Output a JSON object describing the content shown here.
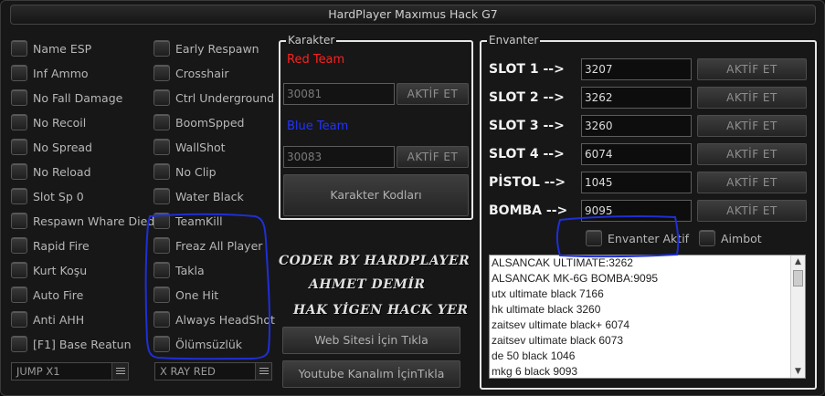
{
  "window": {
    "title": "HardPlayer Maxımus Hack G7"
  },
  "left_column": [
    "Name ESP",
    "Inf Ammo",
    "No Fall Damage",
    "No Recoil",
    "No Spread",
    "No Reload",
    "Slot Sp 0",
    "Respawn Whare Died",
    "Rapid Fire",
    "Kurt Koşu",
    "Auto Fire",
    "Anti AHH",
    "[F1] Base Reatun"
  ],
  "mid_column": [
    "Early Respawn",
    "Crosshair",
    "Ctrl Underground",
    "BoomSpped",
    "WallShot",
    "No Clip",
    "Water Black",
    "TeamKill",
    "Freaz All Player",
    "Takla",
    "One Hit",
    "Always HeadShot",
    "Ölümsüzlük"
  ],
  "combos": {
    "left_value": "JUMP X1",
    "mid_value": "X RAY RED"
  },
  "karakter": {
    "legend": "Karakter",
    "red_label": "Red Team",
    "red_value": "30081",
    "blue_label": "Blue Team",
    "blue_value": "30083",
    "activate_label": "AKTİF ET",
    "codes_button": "Karakter Kodları",
    "colors": {
      "red": "#ff2020",
      "blue": "#2233ff"
    }
  },
  "coder": {
    "line1": "CODER BY HARDPLAYER",
    "line2": "AHMET DEMİR",
    "line3": "HAK YİGEN HACK YER"
  },
  "links": {
    "website": "Web Sitesi İçin Tıkla",
    "youtube": "Youtube Kanalım İçinTıkla"
  },
  "envanter": {
    "legend": "Envanter",
    "activate_label": "AKTİF ET",
    "slots": [
      {
        "label": "SLOT 1 -->",
        "value": "3207"
      },
      {
        "label": "SLOT 2 -->",
        "value": "3262"
      },
      {
        "label": "SLOT 3 -->",
        "value": "3260"
      },
      {
        "label": "SLOT 4 -->",
        "value": "6074"
      },
      {
        "label": "PİSTOL -->",
        "value": "1045"
      },
      {
        "label": "BOMBA -->",
        "value": "9095"
      }
    ],
    "envanter_aktif": "Envanter Aktif",
    "aimbot": "Aimbot",
    "list_items": [
      "ALSANCAK ULTIMATE:3262",
      "ALSANCAK MK-6G BOMBA:9095",
      "utx ultimate black  7166",
      "hk ultimate black 3260",
      "zaitsev ultimate black+ 6074",
      "zaitsev ultimate black 6073",
      "de 50 black 1046",
      "mkg 6 black 9093"
    ]
  },
  "annotation_color": "#1f2fd6"
}
